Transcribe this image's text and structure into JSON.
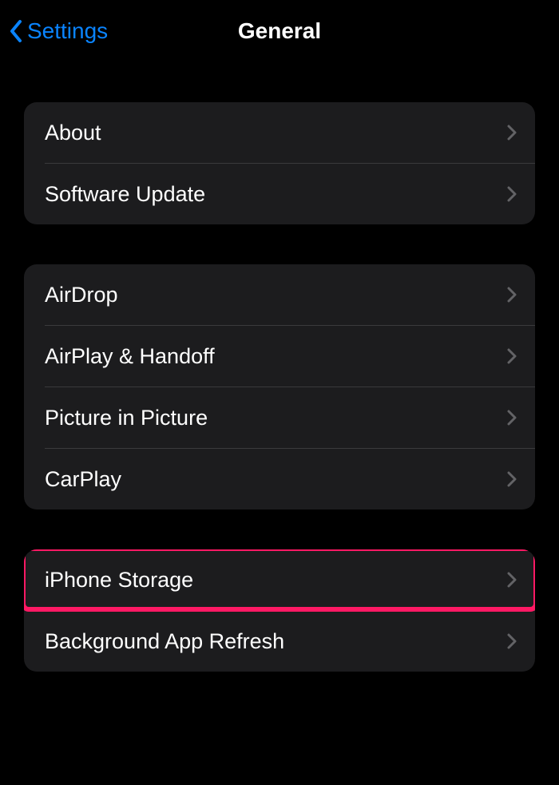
{
  "nav": {
    "back_label": "Settings",
    "title": "General"
  },
  "groups": [
    {
      "items": [
        {
          "label": "About",
          "name": "row-about"
        },
        {
          "label": "Software Update",
          "name": "row-software-update"
        }
      ]
    },
    {
      "items": [
        {
          "label": "AirDrop",
          "name": "row-airdrop"
        },
        {
          "label": "AirPlay & Handoff",
          "name": "row-airplay-handoff"
        },
        {
          "label": "Picture in Picture",
          "name": "row-picture-in-picture"
        },
        {
          "label": "CarPlay",
          "name": "row-carplay"
        }
      ]
    },
    {
      "items": [
        {
          "label": "iPhone Storage",
          "name": "row-iphone-storage",
          "highlighted": true
        },
        {
          "label": "Background App Refresh",
          "name": "row-background-app-refresh"
        }
      ]
    }
  ]
}
